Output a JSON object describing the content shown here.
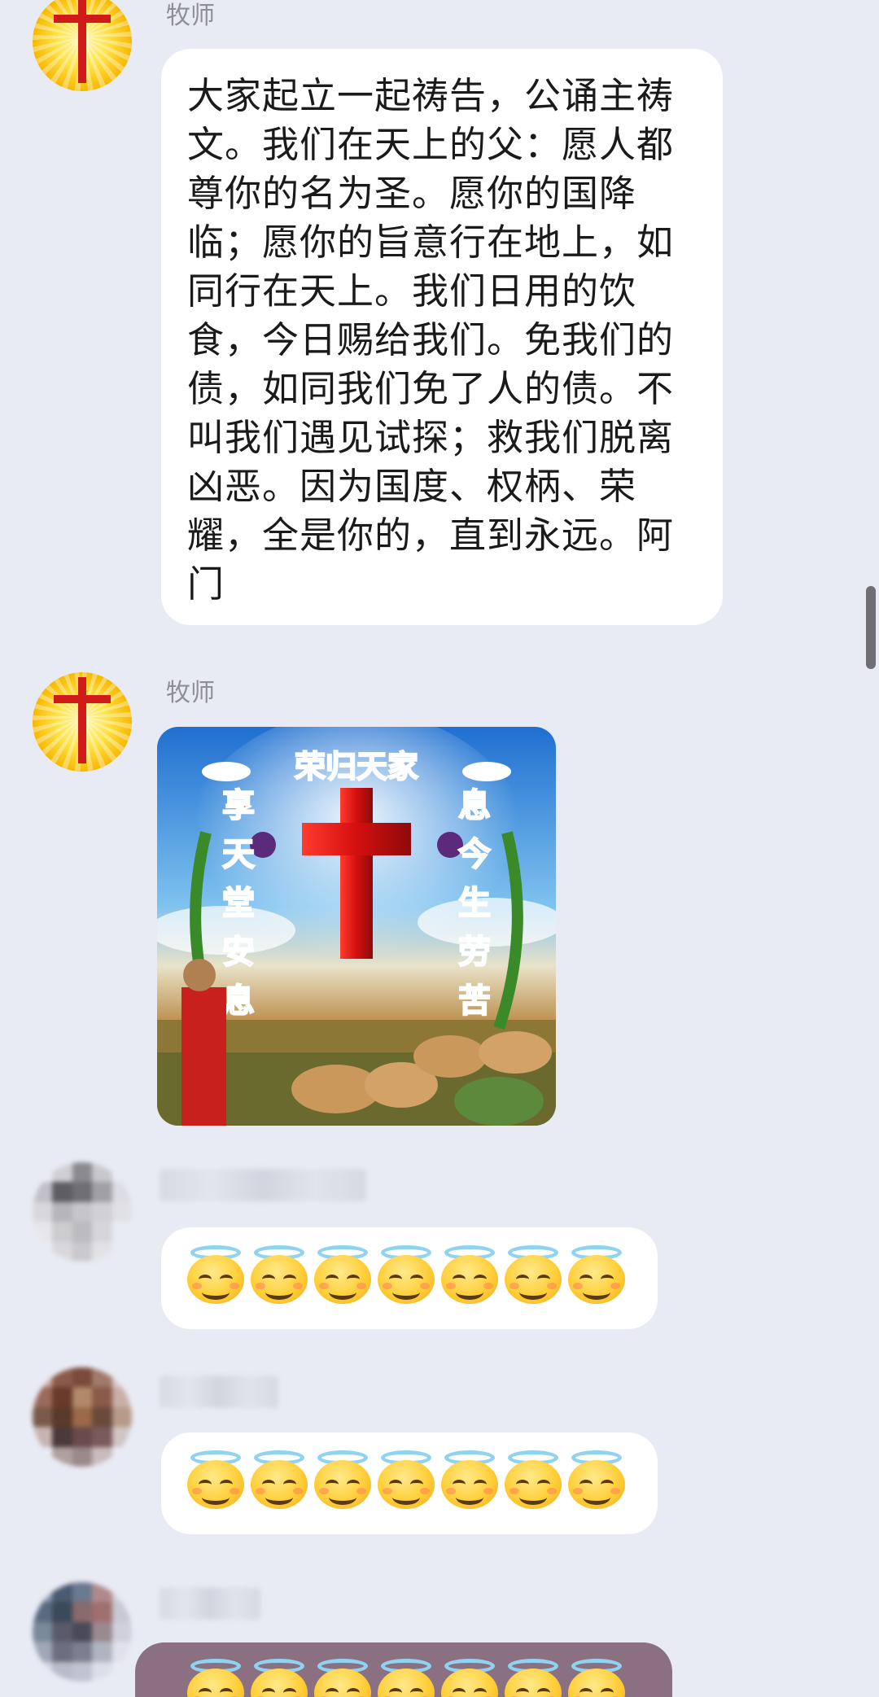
{
  "messages": [
    {
      "sender": "牧师",
      "type": "text",
      "text": "大家起立一起祷告，公诵主祷文。我们在天上的父：愿人都尊你的名为圣。愿你的国降临；愿你的旨意行在地上，如同行在天上。我们日用的饮食，今日赐给我们。免我们的债，如同我们免了人的债。不叫我们遇见试探；救我们脱离凶恶。因为国度、权柄、荣耀，全是你的，直到永远。阿门"
    },
    {
      "sender": "牧师",
      "type": "image",
      "image": {
        "banner": "荣归天家",
        "left_vertical": [
          "享",
          "天",
          "堂",
          "安",
          "息"
        ],
        "right_vertical": [
          "息",
          "今",
          "生",
          "劳",
          "苦"
        ]
      }
    },
    {
      "sender": "",
      "type": "emoji",
      "emoji": "smiling-face-with-halo",
      "count": 7
    },
    {
      "sender": "",
      "type": "emoji",
      "emoji": "smiling-face-with-halo",
      "count": 7
    },
    {
      "sender": "",
      "type": "emoji",
      "emoji": "smiling-face-with-halo",
      "count": 7
    }
  ],
  "colors": {
    "background": "#e9ebf4",
    "bubble": "#ffffff",
    "selected_bubble": "#8a7080",
    "sender_name": "#8e8e96",
    "cross_red": "#d11a1a"
  }
}
